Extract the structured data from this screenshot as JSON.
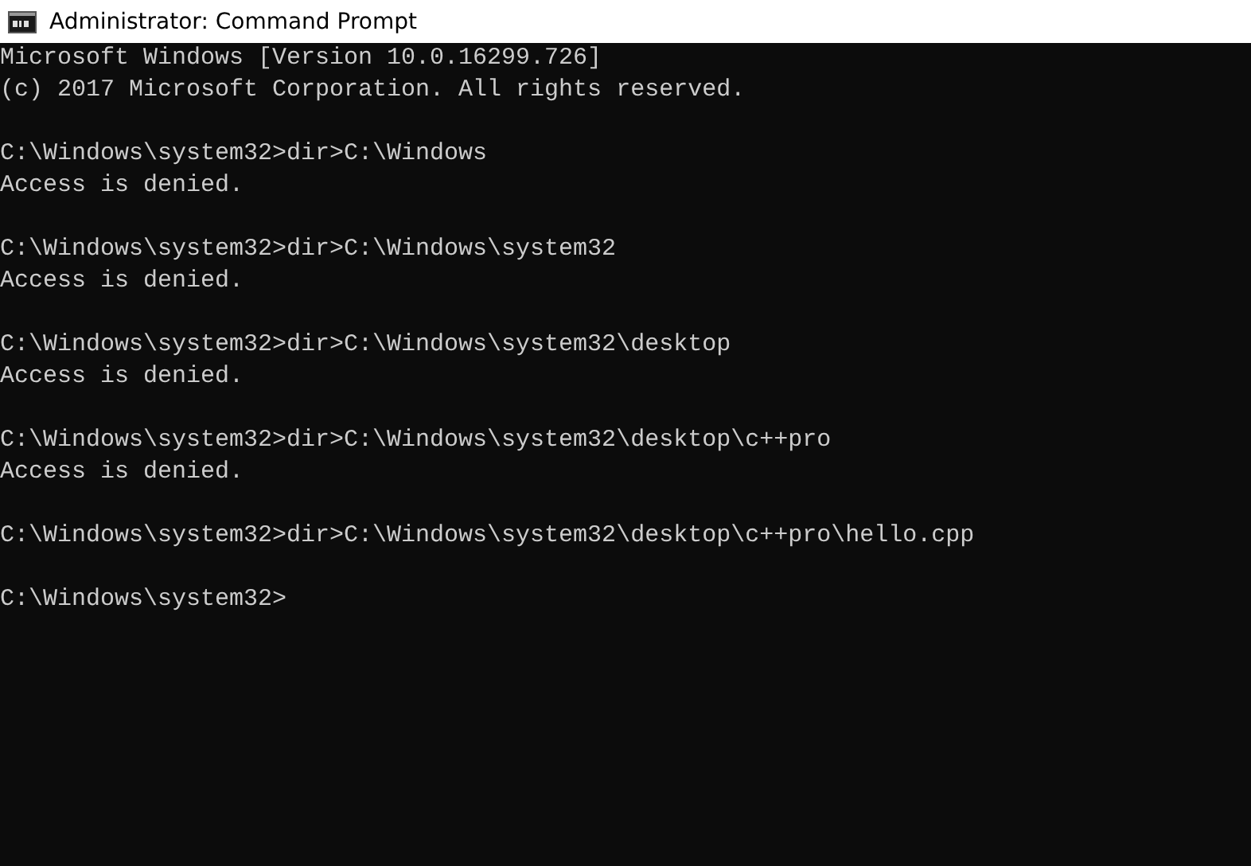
{
  "window": {
    "title": "Administrator: Command Prompt"
  },
  "console": {
    "blocks": [
      [
        "Microsoft Windows [Version 10.0.16299.726]",
        "(c) 2017 Microsoft Corporation. All rights reserved."
      ],
      [
        "C:\\Windows\\system32>dir>C:\\Windows",
        "Access is denied."
      ],
      [
        "C:\\Windows\\system32>dir>C:\\Windows\\system32",
        "Access is denied."
      ],
      [
        "C:\\Windows\\system32>dir>C:\\Windows\\system32\\desktop",
        "Access is denied."
      ],
      [
        "C:\\Windows\\system32>dir>C:\\Windows\\system32\\desktop\\c++pro",
        "Access is denied."
      ],
      [
        "C:\\Windows\\system32>dir>C:\\Windows\\system32\\desktop\\c++pro\\hello.cpp"
      ],
      [
        "C:\\Windows\\system32>"
      ]
    ]
  }
}
